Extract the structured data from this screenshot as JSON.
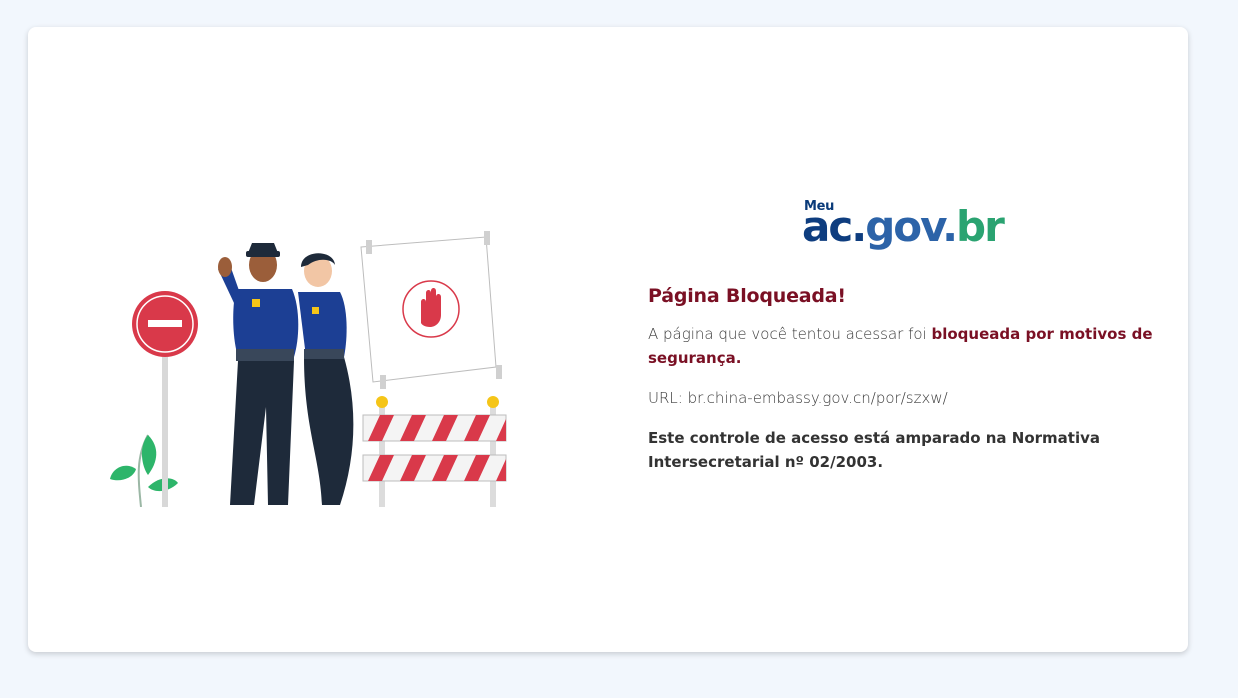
{
  "logo": {
    "meu": "Meu",
    "part1": "ac.",
    "part2": "gov.",
    "part3": "br"
  },
  "title": "Página Bloqueada!",
  "message": {
    "prefix": "A página que você tentou acessar foi ",
    "emphasis": "bloqueada por motivos de segurança."
  },
  "url_line": "URL: br.china-embassy.gov.cn/por/szxw/",
  "legal_note": "Este controle de acesso está amparado na Normativa Intersecretarial nº 02/2003.",
  "colors": {
    "page_bg": "#f2f7fd",
    "card_bg": "#ffffff",
    "title": "#7a1024",
    "logo_dark": "#0e3d7f",
    "logo_mid": "#2c63a8",
    "logo_green": "#2aa371",
    "stop_red": "#d9394a"
  }
}
